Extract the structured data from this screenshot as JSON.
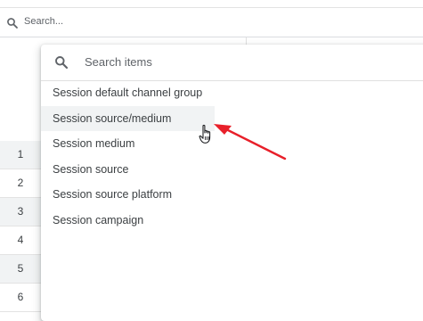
{
  "search": {
    "label": "Search..."
  },
  "table": {
    "row_numbers": [
      "1",
      "2",
      "3",
      "4",
      "5",
      "6"
    ]
  },
  "dropdown": {
    "search_placeholder": "Search items",
    "items": [
      "Session default channel group",
      "Session source/medium",
      "Session medium",
      "Session source",
      "Session source platform",
      "Session campaign"
    ],
    "hovered_item": "Session source/medium"
  },
  "annotation": {
    "arrow_color": "#e8202a"
  },
  "icons": {
    "search": "search-icon",
    "cursor": "hand-pointer-icon"
  }
}
